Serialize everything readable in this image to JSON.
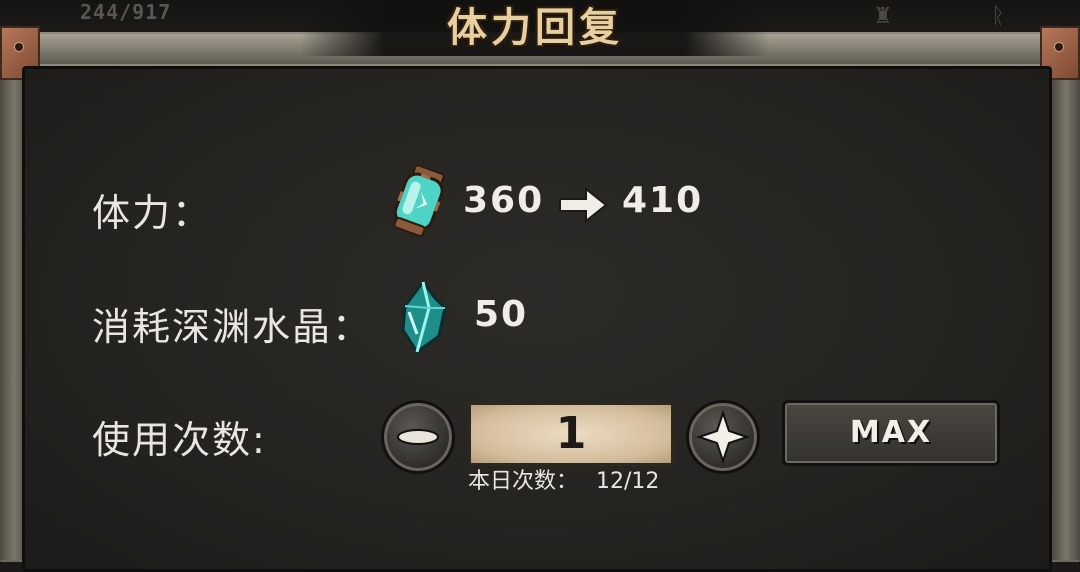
{
  "hud": {
    "counter": "244/917"
  },
  "dialog": {
    "title": "体力回复",
    "stamina_label": "体力：",
    "stamina_from": "360",
    "stamina_to": "410",
    "cost_label": "消耗深渊水晶：",
    "cost_value": "50",
    "uses_label": "使用次数:",
    "use_count": "1",
    "max_label": "MAX",
    "daily_label": "本日次数：",
    "daily_value": "12/12"
  },
  "icons": {
    "stamina": "stamina-potion-icon",
    "crystal": "abyss-crystal-icon",
    "minus": "minus-icon",
    "plus": "plus-icon"
  },
  "colors": {
    "title": "#e8cfa0",
    "panel": "#262421",
    "field": "#ddc8a8"
  }
}
